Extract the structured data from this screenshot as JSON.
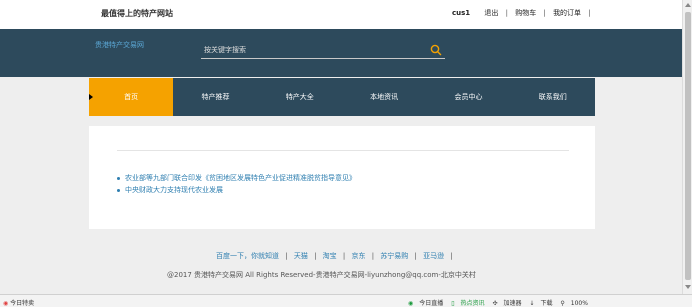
{
  "topbar": {
    "site_name": "最值得上的特产网站",
    "username": "cus1",
    "links": [
      "退出",
      "购物车",
      "我的订单"
    ]
  },
  "header": {
    "logo_text": "贵港特产交易网",
    "search": {
      "placeholder": "按关键字搜索"
    }
  },
  "nav": {
    "items": [
      "首页",
      "特产推荐",
      "特产大全",
      "本地资讯",
      "会员中心",
      "联系我们"
    ],
    "active_index": 0
  },
  "news": {
    "items": [
      "农业部等九部门联合印发《贫困地区发展特色产业促进精准脱贫指导意见》",
      "中央财政大力支持现代农业发展"
    ]
  },
  "footer": {
    "links": [
      "百度一下，你就知道",
      "天猫",
      "淘宝",
      "京东",
      "苏宁易购",
      "亚马逊"
    ],
    "copyright": "@2017 贵港特产交易网 All Rights Reserved-贵港特产交易网-liyunzhong@qq.com-北京中关村"
  },
  "statusbar": {
    "left": "今日特卖",
    "items": [
      "今日直播",
      "热点资讯",
      "加速器",
      "下载",
      "100%"
    ]
  },
  "colors": {
    "header_bg": "#2d4a5c",
    "nav_active": "#f5a200",
    "link": "#2f7fb0",
    "search_icon": "#f5a200"
  }
}
